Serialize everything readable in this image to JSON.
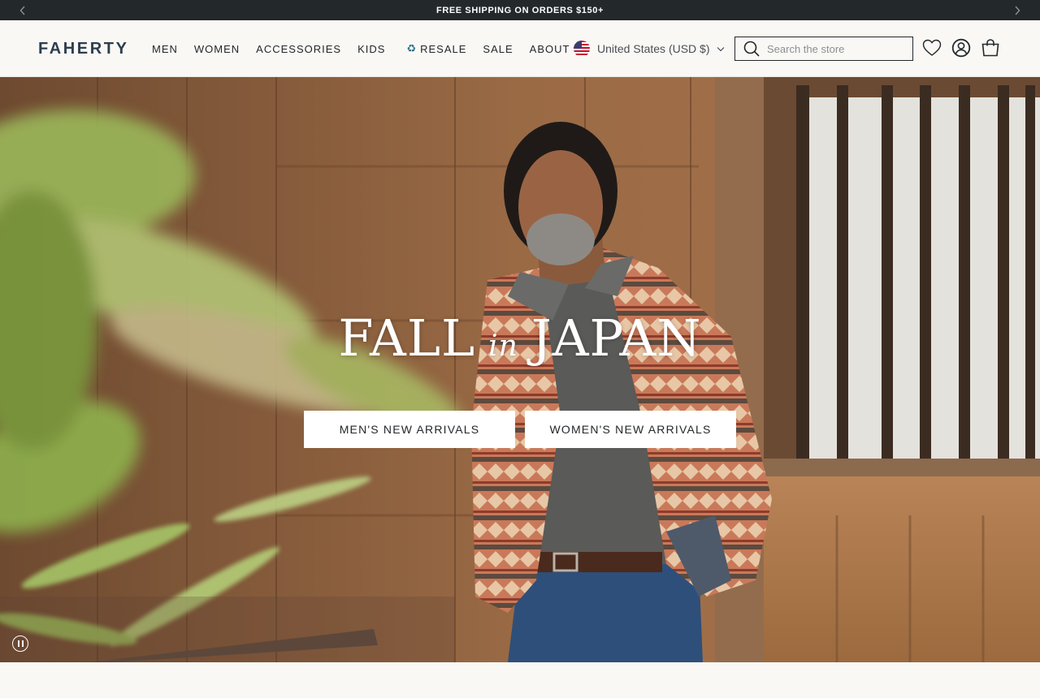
{
  "announcement": {
    "text": "FREE SHIPPING ON ORDERS $150+",
    "prev_icon": "chevron-left-icon",
    "next_icon": "chevron-right-icon"
  },
  "header": {
    "logo": "FAHERTY",
    "nav": [
      {
        "label": "MEN"
      },
      {
        "label": "WOMEN"
      },
      {
        "label": "ACCESSORIES"
      },
      {
        "label": "KIDS"
      },
      {
        "label": "RESALE",
        "icon": "recycle-icon",
        "glyph": "♻"
      },
      {
        "label": "SALE"
      },
      {
        "label": "ABOUT"
      }
    ],
    "country": {
      "label": "United States (USD $)",
      "flag_icon": "us-flag-icon"
    },
    "search": {
      "placeholder": "Search the store",
      "value": ""
    },
    "icons": [
      "heart-icon",
      "account-icon",
      "shopping-bag-icon"
    ]
  },
  "hero": {
    "headline_left": "FALL",
    "headline_mid": "in",
    "headline_right": "JAPAN",
    "cta_men": "MEN'S NEW ARRIVALS",
    "cta_women": "WOMEN'S NEW ARRIVALS",
    "pause_icon": "pause-icon"
  },
  "colors": {
    "announcement_bg": "#23282b",
    "logo": "#2c3e4f",
    "page_bg": "#f9f8f4"
  }
}
